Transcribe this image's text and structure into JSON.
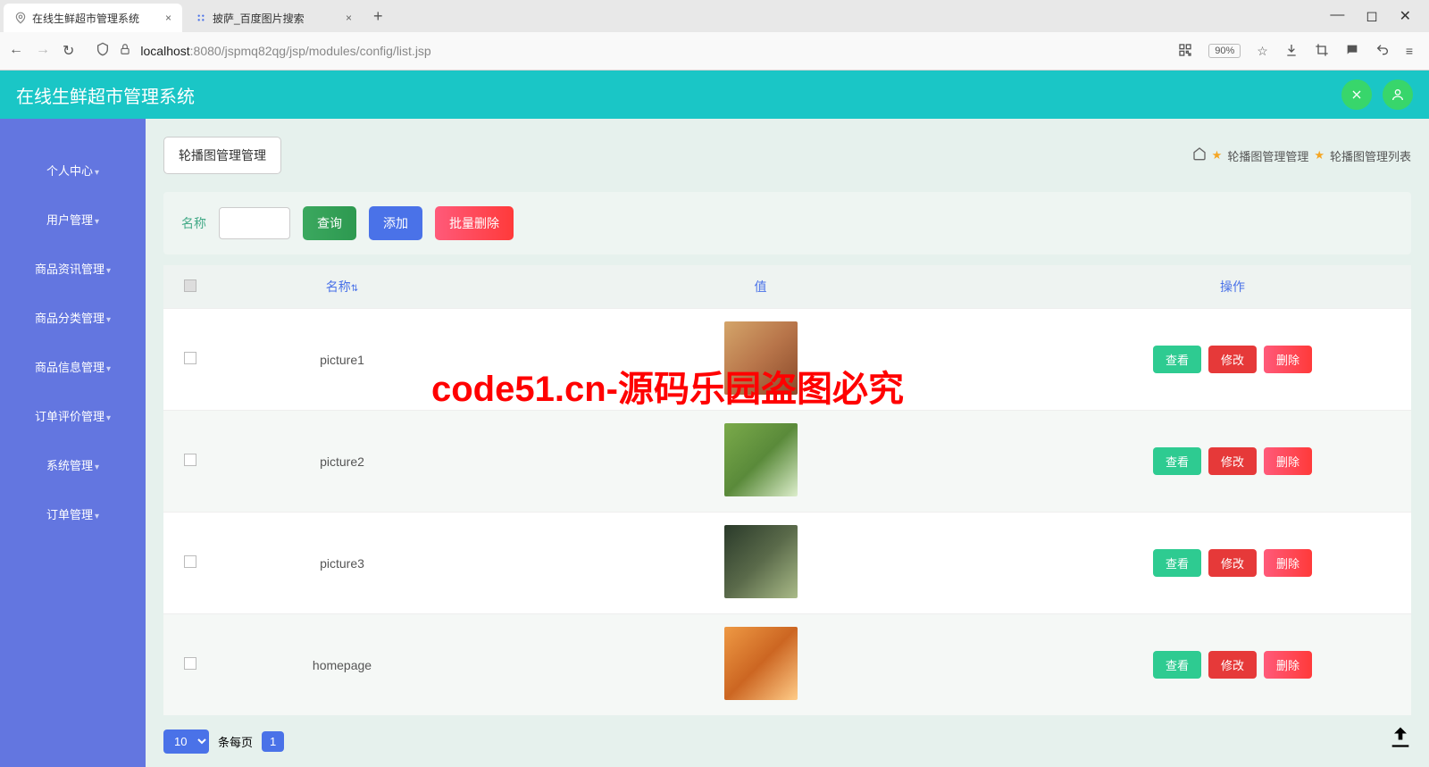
{
  "browser": {
    "tabs": [
      {
        "title": "在线生鲜超市管理系统",
        "active": true
      },
      {
        "title": "披萨_百度图片搜索",
        "active": false
      }
    ],
    "url_host": "localhost",
    "url_path": ":8080/jspmq82qg/jsp/modules/config/list.jsp",
    "zoom": "90%"
  },
  "header": {
    "title": "在线生鲜超市管理系统"
  },
  "sidebar": {
    "items": [
      {
        "label": "个人中心"
      },
      {
        "label": "用户管理"
      },
      {
        "label": "商品资讯管理"
      },
      {
        "label": "商品分类管理"
      },
      {
        "label": "商品信息管理"
      },
      {
        "label": "订单评价管理"
      },
      {
        "label": "系统管理"
      },
      {
        "label": "订单管理"
      }
    ]
  },
  "page": {
    "title_btn": "轮播图管理管理",
    "breadcrumb": {
      "l1": "轮播图管理管理",
      "l2": "轮播图管理列表"
    }
  },
  "filter": {
    "label": "名称",
    "query": "查询",
    "add": "添加",
    "bulk_delete": "批量删除"
  },
  "table": {
    "cols": {
      "name": "名称",
      "value": "值",
      "action": "操作"
    },
    "actions": {
      "view": "查看",
      "edit": "修改",
      "delete": "删除"
    },
    "rows": [
      {
        "name": "picture1"
      },
      {
        "name": "picture2"
      },
      {
        "name": "picture3"
      },
      {
        "name": "homepage"
      }
    ]
  },
  "pagination": {
    "per_page": "10",
    "per_page_label": "条每页",
    "current": "1"
  },
  "watermark": "code51.cn-源码乐园盗图必究"
}
